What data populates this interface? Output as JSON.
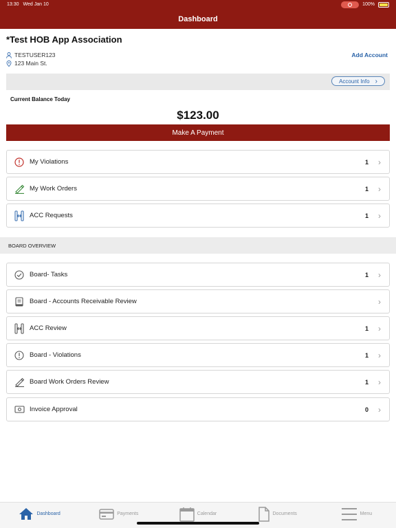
{
  "status": {
    "time": "13:30",
    "date": "Wed Jan 10",
    "battery": "100%"
  },
  "nav": {
    "title": "Dashboard"
  },
  "account": {
    "name": "*Test HOB App Association",
    "user": "TESTUSER123",
    "address": "123 Main St.",
    "add_account": "Add Account",
    "account_info": "Account Info"
  },
  "balance": {
    "label": "Current Balance Today",
    "amount": "$123.00",
    "pay_label": "Make A Payment"
  },
  "my_items": [
    {
      "label": "My Violations",
      "count": "1",
      "icon": "alert-circle-icon"
    },
    {
      "label": "My Work Orders",
      "count": "1",
      "icon": "work-order-icon"
    },
    {
      "label": "ACC Requests",
      "count": "1",
      "icon": "acc-icon"
    }
  ],
  "board": {
    "header": "BOARD OVERVIEW",
    "items": [
      {
        "label": "Board- Tasks",
        "count": "1",
        "icon": "check-circle-icon"
      },
      {
        "label": "Board - Accounts Receivable Review",
        "count": "",
        "icon": "ledger-icon"
      },
      {
        "label": "ACC Review",
        "count": "1",
        "icon": "acc-icon"
      },
      {
        "label": "Board - Violations",
        "count": "1",
        "icon": "alert-circle-icon"
      },
      {
        "label": "Board Work Orders Review",
        "count": "1",
        "icon": "work-order-icon"
      },
      {
        "label": "Invoice Approval",
        "count": "0",
        "icon": "money-icon"
      }
    ]
  },
  "tabs": [
    {
      "label": "Dashboard",
      "icon": "home-icon"
    },
    {
      "label": "Payments",
      "icon": "card-icon"
    },
    {
      "label": "Calendar",
      "icon": "calendar-icon"
    },
    {
      "label": "Documents",
      "icon": "document-icon"
    },
    {
      "label": "Menu",
      "icon": "menu-icon"
    }
  ],
  "colors": {
    "brand": "#8e1a12",
    "link": "#2a63a8",
    "alert": "#c0302a",
    "work": "#3a8a3a",
    "acc": "#3a6fb0"
  }
}
